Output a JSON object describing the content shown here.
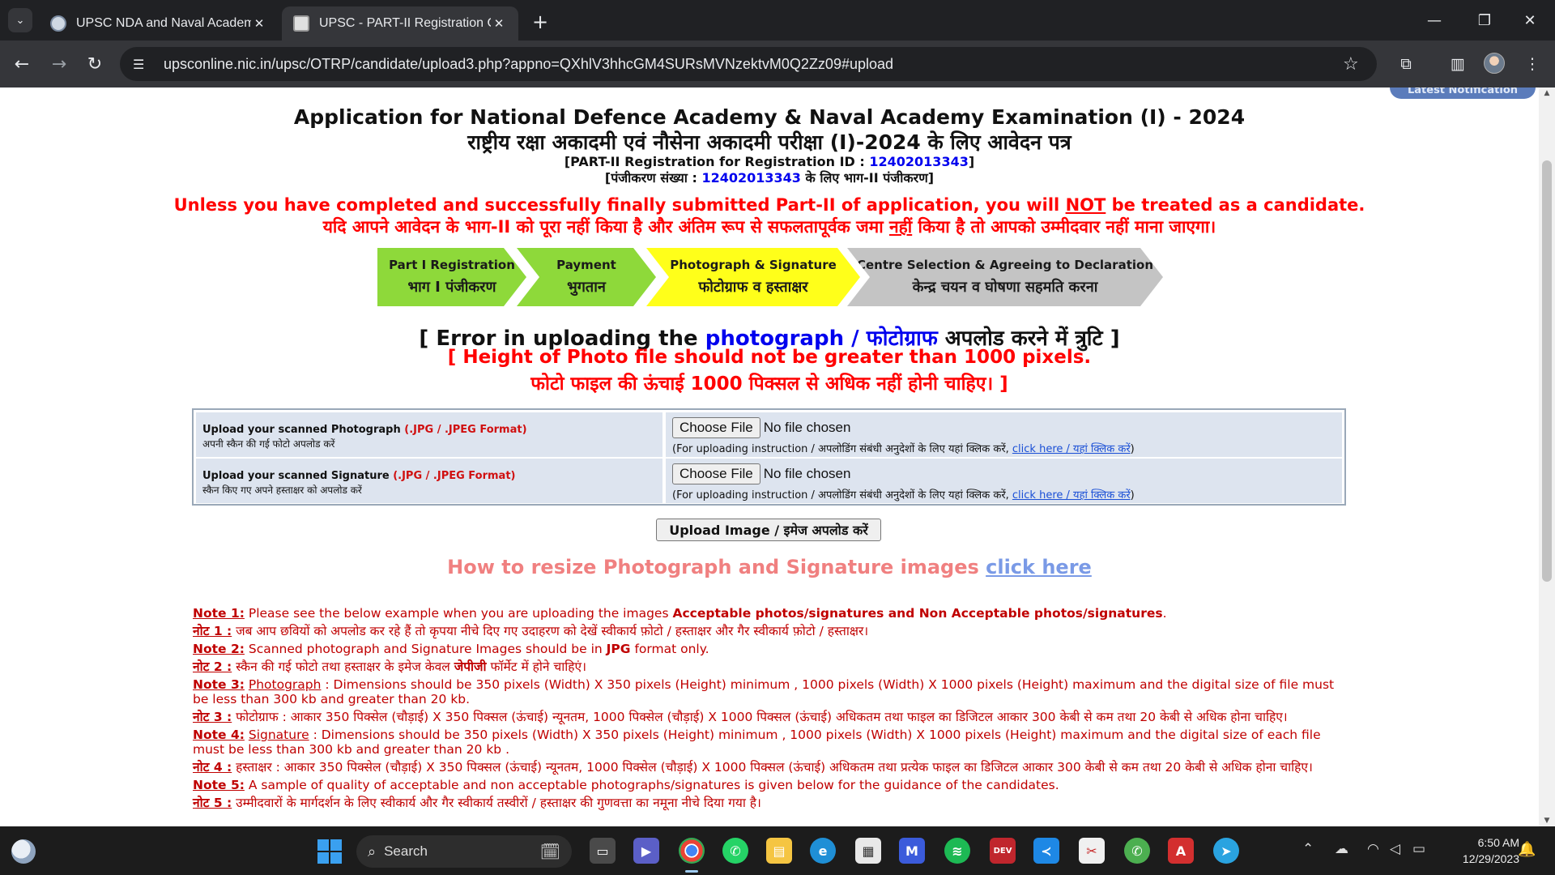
{
  "browser": {
    "tabs": [
      {
        "title": "UPSC NDA and Naval Academy",
        "active": false
      },
      {
        "title": "UPSC - PART-II Registration Cor",
        "active": true
      }
    ],
    "url": "upsconline.nic.in/upsc/OTRP/candidate/upload3.php?appno=QXhlV3hhcGM4SURsMVNzektvM0Q2Zz09#upload"
  },
  "page": {
    "ribbon": "Latest Notification",
    "title_en": "Application for National Defence Academy & Naval Academy Examination (I) - 2024",
    "title_hi": "राष्ट्रीय रक्षा अकादमी एवं नौसेना अकादमी परीक्षा (I)-2024 के लिए आवेदन पत्र",
    "regid_prefix": "[PART-II Registration for Registration ID : ",
    "regid": "12402013343",
    "regid_suffix": "]",
    "regid_hi_prefix": "[पंजीकरण संख्या : ",
    "regid_hi": "12402013343",
    "regid_hi_suffix": " के लिए भाग-II पंजीकरण]",
    "warning_en_a": "Unless you have completed and successfully finally submitted Part-II of application, you will ",
    "warning_en_not": "NOT",
    "warning_en_b": " be treated as a candidate.",
    "warning_hi_a": "यदि आपने आवेदन के भाग-II को पूरा नहीं किया है और अंतिम रूप से सफलतापूर्वक जमा ",
    "warning_hi_not": "नहीं",
    "warning_hi_b": " किया है तो आपको उम्मीदवार नहीं माना जाएगा।",
    "steps": [
      {
        "en": "Part I Registration",
        "hi": "भाग I पंजीकरण"
      },
      {
        "en": "Payment",
        "hi": "भुगतान"
      },
      {
        "en": "Photograph & Signature",
        "hi": "फोटोग्राफ व हस्ताक्षर"
      },
      {
        "en": "Centre Selection & Agreeing to Declaration",
        "hi": "केन्द्र चयन व घोषणा सहमति करना"
      }
    ],
    "error": {
      "open": "[ Error in uploading the ",
      "item_en": "photograph",
      "sep": " / ",
      "item_hi": "फोटोग्राफ",
      "close": " अपलोड करने में त्रुटि ]",
      "msg_en": "[ Height of Photo file should not be greater than 1000 pixels.",
      "msg_hi": "फोटो फाइल की ऊंचाई 1000 पिक्सल से अधिक नहीं होनी चाहिए। ]"
    },
    "upload": {
      "photo_label": "Upload your scanned Photograph",
      "photo_format": " (.JPG / .JPEG Format)",
      "photo_label_hi": "अपनी स्कैन की गई फोटो अपलोड करें",
      "sig_label": "Upload your scanned Signature",
      "sig_format": " (.JPG / .JPEG Format)",
      "sig_label_hi": "स्कैन किए गए अपने हस्ताक्षर को अपलोड करें",
      "choose_file": "Choose File",
      "no_file": "No file chosen",
      "instr_text": "(For uploading instruction / अपलोडिंग संबंधी अनुदेशों के लिए यहां क्लिक करें, ",
      "instr_link": "click here / यहां क्लिक करें",
      "instr_close": ")",
      "button": "Upload Image / इमेज अपलोड करें"
    },
    "resize_text": "How to resize Photograph and Signature images ",
    "resize_link": "click here",
    "notes": [
      {
        "lbl": "Note 1:",
        "pre": " Please see the below example when you are uploading the images ",
        "bold": "Acceptable photos/signatures and Non Acceptable photos/signatures",
        "post": "."
      },
      {
        "lbl": "नोट 1 :",
        "pre": " जब आप छवियों को अपलोड कर रहे हैं तो कृपया नीचे दिए गए उदाहरण को देखें स्वीकार्य फ़ोटो / हस्ताक्षर और गैर स्वीकार्य फ़ोटो / हस्ताक्षर।",
        "bold": "",
        "post": ""
      },
      {
        "lbl": "Note 2:",
        "pre": " Scanned photograph and Signature Images should be in ",
        "bold": "JPG",
        "post": " format only."
      },
      {
        "lbl": "नोट 2 :",
        "pre": " स्कैन की गई फोटो तथा हस्ताक्षर के इमेज केवल ",
        "bold": "जेपीजी",
        "post": " फॉर्मेट में होने चाहिएं।"
      },
      {
        "lbl": "Note 3:",
        "ul": "Photograph",
        "pre": " : Dimensions should be 350 pixels (Width) X 350 pixels (Height) minimum , 1000 pixels (Width) X 1000 pixels (Height) maximum and the digital size of file must be less than 300 kb and greater than 20 kb.",
        "bold": "",
        "post": ""
      },
      {
        "lbl": "नोट 3 :",
        "pre": " फोटोग्राफ : आकार 350 पिक्सेल (चौड़ाई) X 350 पिक्सल (ऊंचाई) न्यूनतम, 1000 पिक्सेल (चौड़ाई) X 1000 पिक्सल (ऊंचाई) अधिकतम तथा फाइल का डिजिटल आकार 300 केबी से कम तथा 20 केबी से अधिक होना चाहिए।",
        "bold": "",
        "post": ""
      },
      {
        "lbl": "Note 4:",
        "ul": "Signature",
        "pre": " : Dimensions should be 350 pixels (Width) X 350 pixels (Height) minimum , 1000 pixels (Width) X 1000 pixels (Height) maximum and the digital size of each file must be less than 300 kb and greater than 20 kb .",
        "bold": "",
        "post": ""
      },
      {
        "lbl": "नोट 4 :",
        "pre": " हस्ताक्षर : आकार 350 पिक्सेल (चौड़ाई) X 350 पिक्सल (ऊंचाई) न्यूनतम, 1000 पिक्सेल (चौड़ाई) X 1000 पिक्सल (ऊंचाई) अधिकतम तथा प्रत्येक फाइल का डिजिटल आकार 300 केबी से कम तथा 20 केबी से अधिक होना चाहिए।",
        "bold": "",
        "post": ""
      },
      {
        "lbl": "Note 5:",
        "pre": " A sample of quality of acceptable and non acceptable photographs/signatures is given below for the guidance of the candidates.",
        "bold": "",
        "post": ""
      },
      {
        "lbl": "नोट 5 :",
        "pre": " उम्मीदवारों के मार्गदर्शन के लिए स्वीकार्य और गैर स्वीकार्य तस्वीरों / हस्ताक्षर की गुणवत्ता का नमूना नीचे दिया गया है।",
        "bold": "",
        "post": ""
      }
    ]
  },
  "taskbar": {
    "search": "Search",
    "time": "6:50 AM",
    "date": "12/29/2023"
  }
}
